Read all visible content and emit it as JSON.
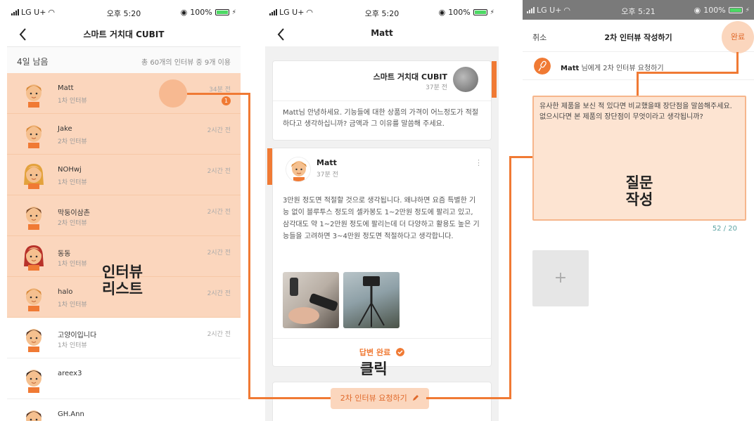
{
  "status_bar": {
    "carrier": "LG U+",
    "battery": "100%",
    "times": [
      "오후 5:20",
      "오후 5:20",
      "오후 5:21"
    ]
  },
  "screen_list": {
    "title": "스마트 거치대 CUBIT",
    "remaining": "4일 남음",
    "usage": "총 60개의 인터뷰 중 9개 이용",
    "items": [
      {
        "name": "Matt",
        "sub": "1차 인터뷰",
        "time": "34분 전",
        "badge": "1",
        "highlighted": true
      },
      {
        "name": "Jake",
        "sub": "2차 인터뷰",
        "time": "2시간 전",
        "highlighted": true
      },
      {
        "name": "NOHwj",
        "sub": "1차 인터뷰",
        "time": "2시간 전",
        "highlighted": true
      },
      {
        "name": "막둥이삼촌",
        "sub": "2차 인터뷰",
        "time": "2시간 전",
        "highlighted": true
      },
      {
        "name": "동동",
        "sub": "1차 인터뷰",
        "time": "2시간 전",
        "highlighted": true
      },
      {
        "name": "halo",
        "sub": "1차 인터뷰",
        "time": "2시간 전",
        "highlighted": true
      },
      {
        "name": "고양이입니다",
        "sub": "1차 인터뷰",
        "time": "2시간 전",
        "highlighted": false
      },
      {
        "name": "areex3",
        "sub": "",
        "time": "",
        "highlighted": false
      },
      {
        "name": "GH.Ann",
        "sub": "",
        "time": "",
        "highlighted": false
      }
    ],
    "overlay_label_line1": "인터뷰",
    "overlay_label_line2": "리스트"
  },
  "screen_detail": {
    "title": "Matt",
    "question_card": {
      "title": "스마트 거치대 CUBIT",
      "time": "37분 전",
      "text": "Matt님 안녕하세요. 기능들에 대한 상품의 가격이 어느정도가 적절하다고 생각하십니까? 금액과 그 이유를 말씀해 주세요."
    },
    "answer_card": {
      "name": "Matt",
      "time": "37분 전",
      "text": "3만원 정도면 적절할 것으로 생각됩니다. 왜냐하면 요즘 특별한 기능 없이 블루투스 정도의 셀카봉도 1~2만원 정도에 팔리고 있고, 삼각대도 약 1~2만원 정도에 팔리는데 더 다양하고 활용도 높은 기능들을 고려하면 3~4만원 정도면 적절하다고 생각합니다.",
      "done_label": "답변 완료"
    },
    "click_label": "클릭",
    "request_button": "2차 인터뷰 요청하기"
  },
  "screen_compose": {
    "cancel": "취소",
    "title": "2차 인터뷰 작성하기",
    "done": "완료",
    "target_name": "Matt",
    "target_suffix": "님에게 2차 인터뷰 요청하기",
    "question": "유사한 제품을 보신 적 있다면 비교했을때 장단점을 말씀해주세요. 없으시다면 본 제품의 장단점이 무엇이라고 생각됩니까?",
    "overlay_label_line1": "질문",
    "overlay_label_line2": "작성",
    "counter": "52 / 20",
    "add_symbol": "+"
  },
  "colors": {
    "accent": "#f07a34",
    "highlight": "#fbd6bd"
  }
}
